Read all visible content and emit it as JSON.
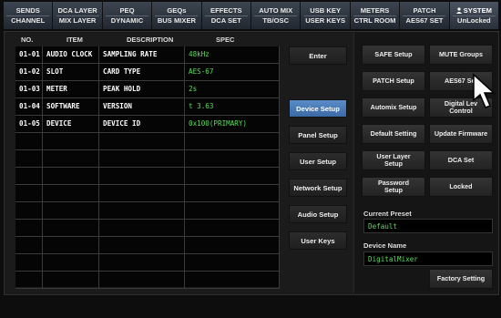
{
  "nav": {
    "tabs": [
      {
        "l1": "SENDS",
        "l2": "CHANNEL"
      },
      {
        "l1": "DCA LAYER",
        "l2": "MIX LAYER"
      },
      {
        "l1": "PEQ",
        "l2": "DYNAMIC"
      },
      {
        "l1": "GEQs",
        "l2": "BUS MIXER"
      },
      {
        "l1": "EFFECTS",
        "l2": "DCA SET"
      },
      {
        "l1": "AUTO MIX",
        "l2": "TB/OSC"
      },
      {
        "l1": "USB KEY",
        "l2": "USER KEYS"
      },
      {
        "l1": "METERS",
        "l2": "CTRL ROOM"
      },
      {
        "l1": "PATCH",
        "l2": "AES67 SET"
      },
      {
        "l1": "SYSTEM",
        "l2": "UnLocked"
      }
    ]
  },
  "table": {
    "headers": {
      "no": "NO.",
      "item": "ITEM",
      "description": "DESCRIPTION",
      "spec": "SPEC"
    },
    "rows": [
      {
        "no": "01-01",
        "item": "AUDIO CLOCK",
        "description": "SAMPLING RATE",
        "spec": "48kHz"
      },
      {
        "no": "01-02",
        "item": "SLOT",
        "description": "CARD TYPE",
        "spec": "AES-67"
      },
      {
        "no": "01-03",
        "item": "METER",
        "description": "PEAK HOLD",
        "spec": "2s"
      },
      {
        "no": "01-04",
        "item": "SOFTWARE",
        "description": "VERSION",
        "spec": "t 3.63"
      },
      {
        "no": "01-05",
        "item": "DEVICE",
        "description": "DEVICE ID",
        "spec": "0x100(PRIMARY)"
      }
    ]
  },
  "middle_buttons": {
    "enter": "Enter",
    "device_setup": "Device Setup",
    "panel_setup": "Panel Setup",
    "user_setup": "User Setup",
    "network_setup": "Network Setup",
    "audio_setup": "Audio Setup",
    "user_keys": "User Keys"
  },
  "right_panel": {
    "safe_setup": "SAFE Setup",
    "mute_groups": "MUTE Groups",
    "patch_setup": "PATCH Setup",
    "aes67_set": "AES67 Set",
    "automix_setup": "Automix Setup",
    "digital_lev_control_1": "Digital Lev",
    "digital_lev_control_2": "Control",
    "default_setting": "Default Setting",
    "update_firmware": "Update Firmware",
    "user_layer_setup_1": "User Layer",
    "user_layer_setup_2": "Setup",
    "dca_set": "DCA Set",
    "password_setup_1": "Password",
    "password_setup_2": "Setup",
    "locked": "Locked",
    "current_preset_label": "Current Preset",
    "current_preset_value": "Default",
    "device_name_label": "Device Name",
    "device_name_value": "DigitalMixer",
    "factory_setting": "Factory Setting"
  },
  "colors": {
    "accent_blue": "#4a7bbd",
    "spec_green": "#5edd5e"
  }
}
